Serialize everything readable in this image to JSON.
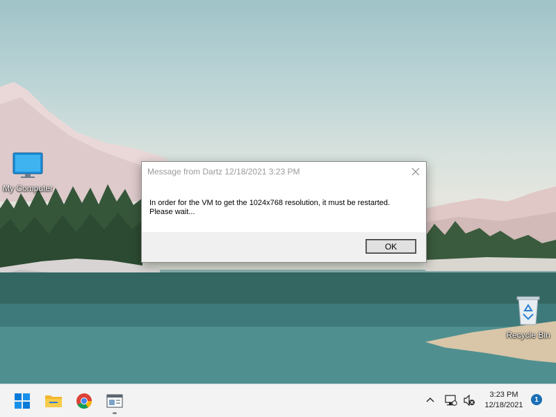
{
  "desktop": {
    "icons": [
      {
        "label": "My Computer",
        "icon": "monitor-icon"
      },
      {
        "label": "Recycle Bin",
        "icon": "recycle-bin-icon"
      }
    ]
  },
  "dialog": {
    "title": "Message from Dartz 12/18/2021 3:23 PM",
    "message_lines": [
      "In order for the VM to get the 1024x768 resolution, it must be restarted.",
      "Please wait..."
    ],
    "ok_label": "OK",
    "close_icon": "close-icon"
  },
  "taskbar": {
    "apps": [
      {
        "name": "Start",
        "icon": "windows-logo-icon"
      },
      {
        "name": "File Explorer",
        "icon": "folder-icon"
      },
      {
        "name": "Google Chrome",
        "icon": "chrome-icon"
      },
      {
        "name": "Application window",
        "icon": "app-window-icon"
      }
    ],
    "tray": {
      "overflow_icon": "chevron-up-icon",
      "network_icon": "network-icon",
      "volume_icon": "volume-muted-icon"
    },
    "clock": {
      "time": "3:23 PM",
      "date": "12/18/2021"
    },
    "notification_count": "1"
  },
  "colors": {
    "accent": "#0078d4",
    "taskbar_bg": "#f3f3f3",
    "dialog_footer": "#f0f0f0"
  }
}
